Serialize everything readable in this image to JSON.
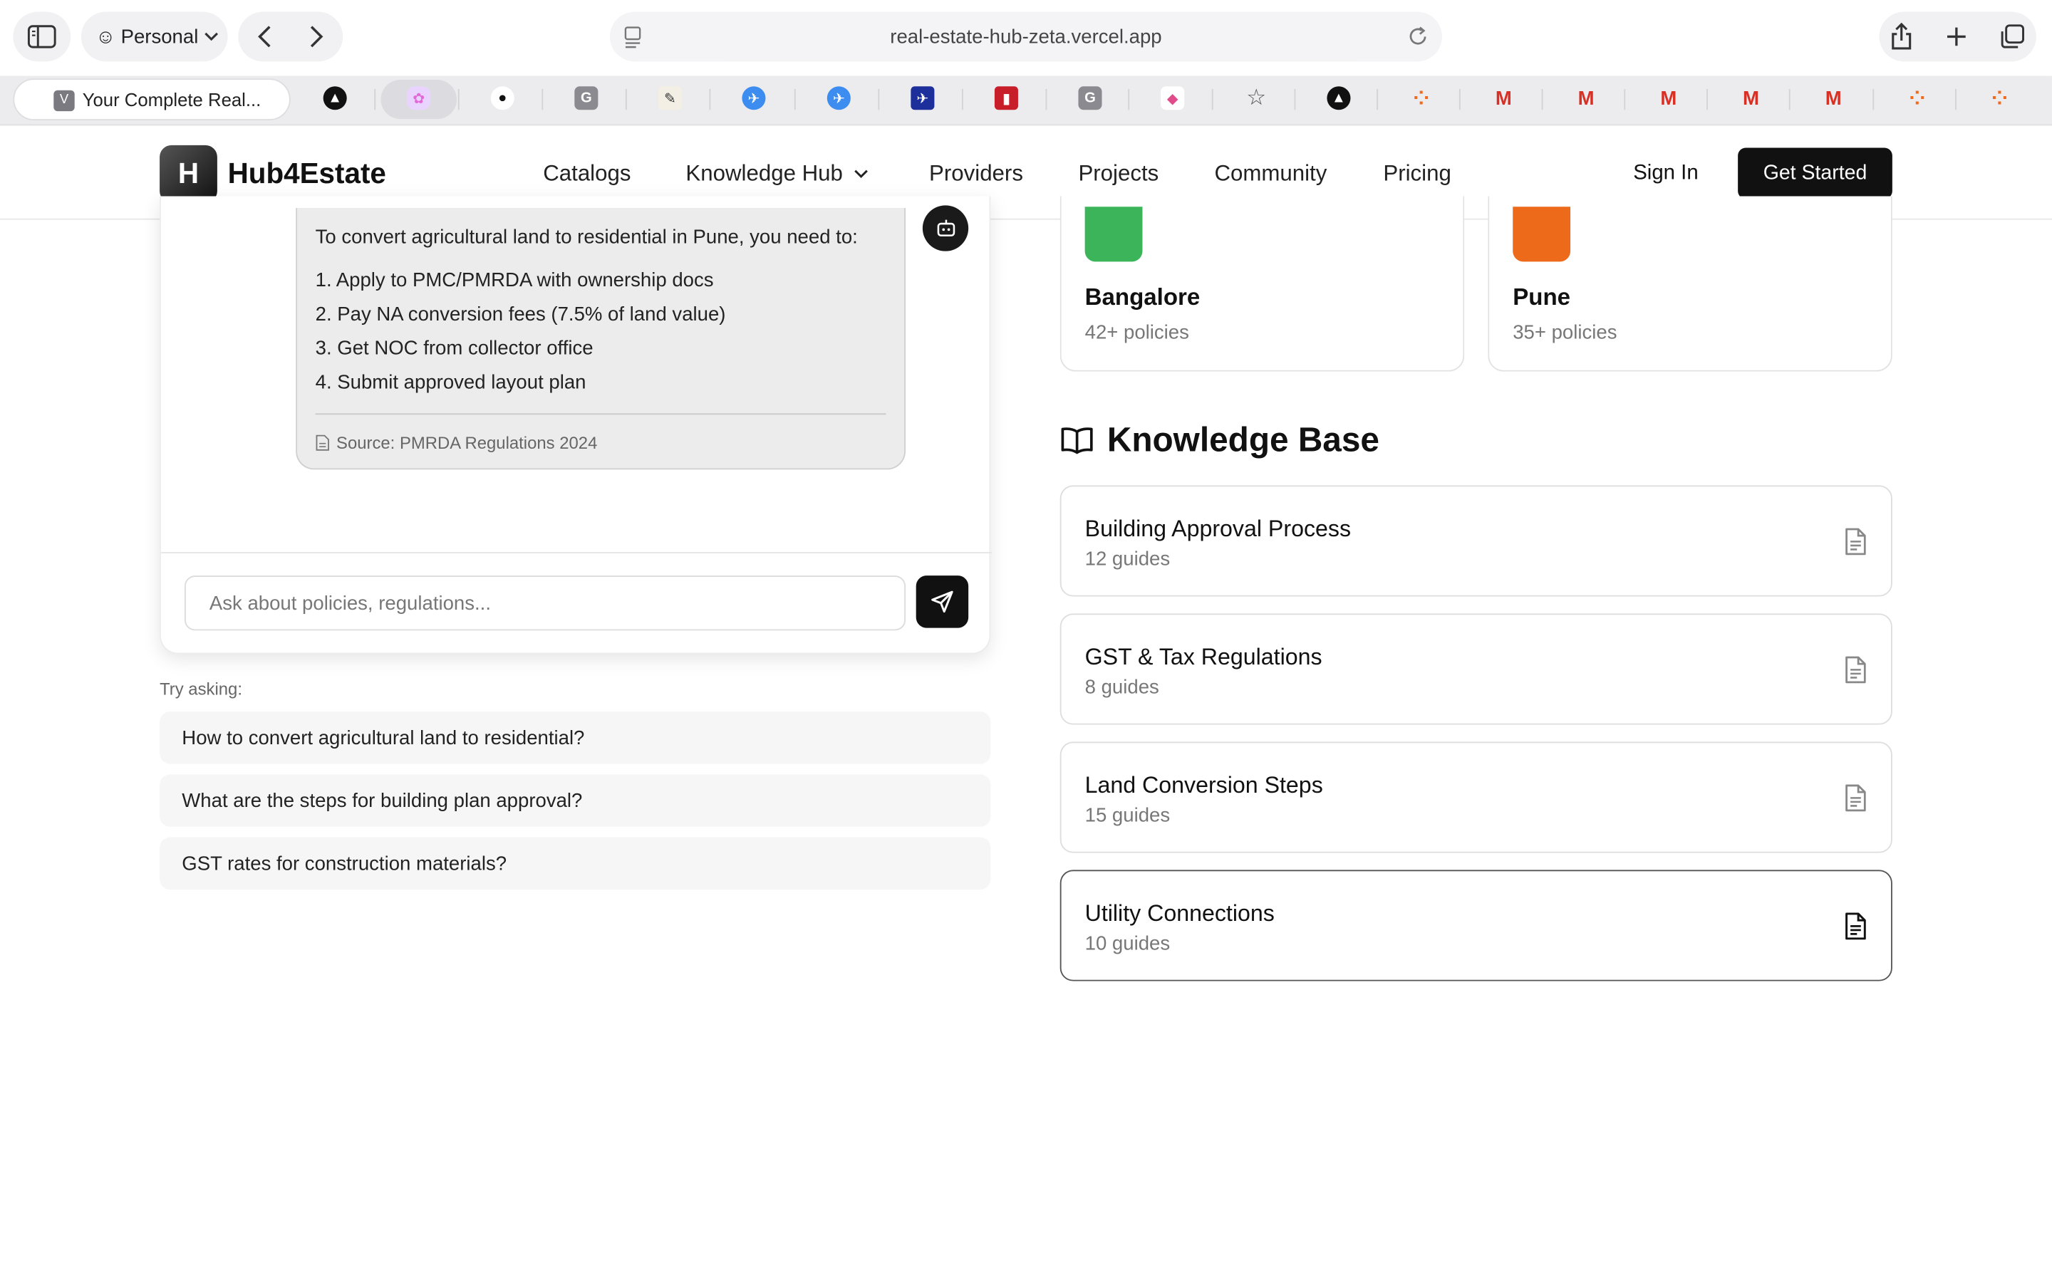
{
  "browser": {
    "profile_label": "Personal",
    "url": "real-estate-hub-zeta.vercel.app",
    "active_tab": {
      "favicon_letter": "V",
      "title": "Your Complete Real..."
    },
    "pinned_tabs": [
      {
        "icon": "triangle-logo-icon",
        "glyph": "▲"
      },
      {
        "icon": "pink-flower-icon",
        "glyph": "✿"
      },
      {
        "icon": "github-icon",
        "glyph": "●"
      },
      {
        "icon": "g-app-icon",
        "glyph": "G"
      },
      {
        "icon": "drawing-app-icon",
        "glyph": "✎"
      },
      {
        "icon": "compass-blue-icon",
        "glyph": "✈"
      },
      {
        "icon": "compass-blue-icon-2",
        "glyph": "✈"
      },
      {
        "icon": "plane-dark-icon",
        "glyph": "✈"
      },
      {
        "icon": "red-book-icon",
        "glyph": "▮"
      },
      {
        "icon": "g-app-icon-2",
        "glyph": "G"
      },
      {
        "icon": "gradient-app-icon",
        "glyph": "◆"
      },
      {
        "icon": "star-icon",
        "glyph": "☆"
      },
      {
        "icon": "triangle-logo-icon-2",
        "glyph": "▲"
      },
      {
        "icon": "orange-dots-icon",
        "glyph": "⁘"
      },
      {
        "icon": "gmail-icon",
        "glyph": "M"
      },
      {
        "icon": "gmail-icon-2",
        "glyph": "M"
      },
      {
        "icon": "gmail-icon-3",
        "glyph": "M"
      },
      {
        "icon": "gmail-icon-4",
        "glyph": "M"
      },
      {
        "icon": "gmail-icon-5",
        "glyph": "M"
      },
      {
        "icon": "orange-dots-icon-2",
        "glyph": "⁘"
      },
      {
        "icon": "orange-dots-icon-3",
        "glyph": "⁘"
      }
    ]
  },
  "header": {
    "logo_letter": "H",
    "brand": "Hub4Estate",
    "nav": [
      "Catalogs",
      "Knowledge Hub",
      "Providers",
      "Projects",
      "Community",
      "Pricing"
    ],
    "sign_in": "Sign In",
    "get_started": "Get Started"
  },
  "chat": {
    "bot_intro": "To convert agricultural land to residential in Pune, you need to:",
    "steps": [
      "1. Apply to PMC/PMRDA with ownership docs",
      "2. Pay NA conversion fees (7.5% of land value)",
      "3. Get NOC from collector office",
      "4. Submit approved layout plan"
    ],
    "source": "Source: PMRDA Regulations 2024",
    "input_placeholder": "Ask about policies, regulations..."
  },
  "suggestions": {
    "label": "Try asking:",
    "items": [
      "How to convert agricultural land to residential?",
      "What are the steps for building plan approval?",
      "GST rates for construction materials?"
    ]
  },
  "cities": [
    {
      "name": "Bangalore",
      "count": "42+ policies",
      "color": "#3cb55a"
    },
    {
      "name": "Pune",
      "count": "35+ policies",
      "color": "#ec6a1a"
    }
  ],
  "knowledge_base": {
    "title": "Knowledge Base",
    "items": [
      {
        "title": "Building Approval Process",
        "count": "12 guides"
      },
      {
        "title": "GST & Tax Regulations",
        "count": "8 guides"
      },
      {
        "title": "Land Conversion Steps",
        "count": "15 guides"
      },
      {
        "title": "Utility Connections",
        "count": "10 guides"
      }
    ]
  }
}
